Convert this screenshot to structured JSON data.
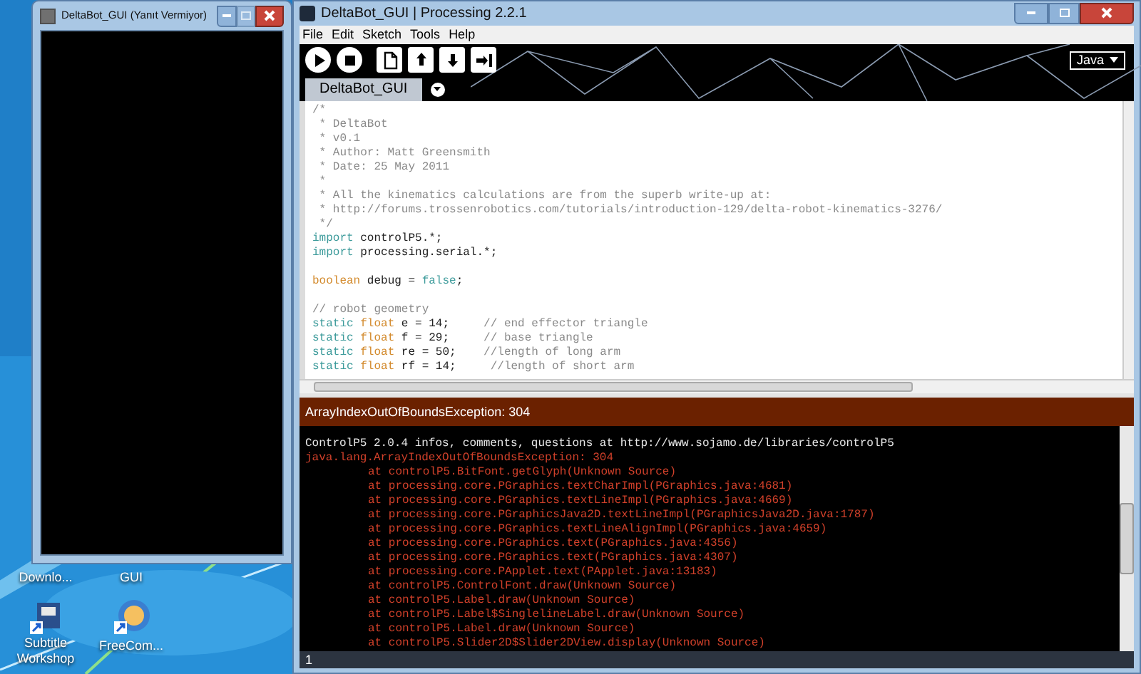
{
  "desktop": {
    "icons": [
      {
        "label": "Downlo...",
        "kind": "partial"
      },
      {
        "label": "GUI",
        "kind": "partial"
      },
      {
        "label": "Subtitle Workshop",
        "kind": "film"
      },
      {
        "label": "FreeCom...",
        "kind": "globe"
      }
    ]
  },
  "sketch_window": {
    "title": "DeltaBot_GUI (Yanıt Vermiyor)"
  },
  "ide_window": {
    "title": "DeltaBot_GUI | Processing 2.2.1",
    "menu": [
      "File",
      "Edit",
      "Sketch",
      "Tools",
      "Help"
    ],
    "toolbar": [
      {
        "kind": "run"
      },
      {
        "kind": "stop"
      },
      {
        "kind": "new"
      },
      {
        "kind": "open"
      },
      {
        "kind": "save"
      },
      {
        "kind": "export"
      }
    ],
    "mode": "Java",
    "tabs": [
      {
        "label": "DeltaBot_GUI",
        "selected": true
      }
    ],
    "code": [
      {
        "kind": "code",
        "tokens": [
          {
            "text": "/*",
            "kind": "comment"
          }
        ]
      },
      {
        "kind": "code",
        "tokens": [
          {
            "text": " * DeltaBot",
            "kind": "comment"
          }
        ]
      },
      {
        "kind": "code",
        "tokens": [
          {
            "text": " * v0.1",
            "kind": "comment"
          }
        ]
      },
      {
        "kind": "code",
        "tokens": [
          {
            "text": " * Author: Matt Greensmith",
            "kind": "comment"
          }
        ]
      },
      {
        "kind": "code",
        "tokens": [
          {
            "text": " * Date: 25 May 2011",
            "kind": "comment"
          }
        ]
      },
      {
        "kind": "code",
        "tokens": [
          {
            "text": " *",
            "kind": "comment"
          }
        ]
      },
      {
        "kind": "code",
        "tokens": [
          {
            "text": " * All the kinematics calculations are from the superb write-up at:",
            "kind": "comment"
          }
        ]
      },
      {
        "kind": "code",
        "tokens": [
          {
            "text": " * http://forums.trossenrobotics.com/tutorials/introduction-129/delta-robot-kinematics-3276/",
            "kind": "comment"
          }
        ]
      },
      {
        "kind": "code",
        "tokens": [
          {
            "text": " */",
            "kind": "comment"
          }
        ]
      },
      {
        "kind": "code",
        "tokens": [
          {
            "text": "import",
            "kind": "keyword"
          },
          {
            "text": " controlP5.*;",
            "kind": "plain"
          }
        ]
      },
      {
        "kind": "code",
        "tokens": [
          {
            "text": "import",
            "kind": "keyword"
          },
          {
            "text": " processing.serial.*;",
            "kind": "plain"
          }
        ]
      },
      {
        "kind": "blank"
      },
      {
        "kind": "code",
        "tokens": [
          {
            "text": "boolean",
            "kind": "type"
          },
          {
            "text": " debug = ",
            "kind": "plain"
          },
          {
            "text": "false",
            "kind": "literal"
          },
          {
            "text": ";",
            "kind": "plain"
          }
        ]
      },
      {
        "kind": "blank"
      },
      {
        "kind": "code",
        "tokens": [
          {
            "text": "// robot geometry",
            "kind": "comment"
          }
        ]
      },
      {
        "kind": "code",
        "tokens": [
          {
            "text": "static ",
            "kind": "keyword"
          },
          {
            "text": "float",
            "kind": "type"
          },
          {
            "text": " e = 14;     ",
            "kind": "plain"
          },
          {
            "text": "// end effector triangle",
            "kind": "comment"
          }
        ]
      },
      {
        "kind": "code",
        "tokens": [
          {
            "text": "static ",
            "kind": "keyword"
          },
          {
            "text": "float",
            "kind": "type"
          },
          {
            "text": " f = 29;     ",
            "kind": "plain"
          },
          {
            "text": "// base triangle",
            "kind": "comment"
          }
        ]
      },
      {
        "kind": "code",
        "tokens": [
          {
            "text": "static ",
            "kind": "keyword"
          },
          {
            "text": "float",
            "kind": "type"
          },
          {
            "text": " re = 50;    ",
            "kind": "plain"
          },
          {
            "text": "//length of long arm",
            "kind": "comment"
          }
        ]
      },
      {
        "kind": "code",
        "tokens": [
          {
            "text": "static ",
            "kind": "keyword"
          },
          {
            "text": "float",
            "kind": "type"
          },
          {
            "text": " rf = 14;     ",
            "kind": "plain"
          },
          {
            "text": "//length of short arm",
            "kind": "comment"
          }
        ]
      }
    ],
    "error_bar": "ArrayIndexOutOfBoundsException: 304",
    "console": [
      {
        "kind": "info",
        "text": "ControlP5 2.0.4 infos, comments, questions at http://www.sojamo.de/libraries/controlP5"
      },
      {
        "kind": "error",
        "text": "java.lang.ArrayIndexOutOfBoundsException: 304"
      },
      {
        "kind": "trace",
        "text": "at controlP5.BitFont.getGlyph(Unknown Source)"
      },
      {
        "kind": "trace",
        "text": "at processing.core.PGraphics.textCharImpl(PGraphics.java:4681)"
      },
      {
        "kind": "trace",
        "text": "at processing.core.PGraphics.textLineImpl(PGraphics.java:4669)"
      },
      {
        "kind": "trace",
        "text": "at processing.core.PGraphicsJava2D.textLineImpl(PGraphicsJava2D.java:1787)"
      },
      {
        "kind": "trace",
        "text": "at processing.core.PGraphics.textLineAlignImpl(PGraphics.java:4659)"
      },
      {
        "kind": "trace",
        "text": "at processing.core.PGraphics.text(PGraphics.java:4356)"
      },
      {
        "kind": "trace",
        "text": "at processing.core.PGraphics.text(PGraphics.java:4307)"
      },
      {
        "kind": "trace",
        "text": "at processing.core.PApplet.text(PApplet.java:13183)"
      },
      {
        "kind": "trace",
        "text": "at controlP5.ControlFont.draw(Unknown Source)"
      },
      {
        "kind": "trace",
        "text": "at controlP5.Label.draw(Unknown Source)"
      },
      {
        "kind": "trace",
        "text": "at controlP5.Label$SinglelineLabel.draw(Unknown Source)"
      },
      {
        "kind": "trace",
        "text": "at controlP5.Label.draw(Unknown Source)"
      },
      {
        "kind": "trace",
        "text": "at controlP5.Slider2D$Slider2DView.display(Unknown Source)"
      }
    ],
    "status_line": "1"
  }
}
